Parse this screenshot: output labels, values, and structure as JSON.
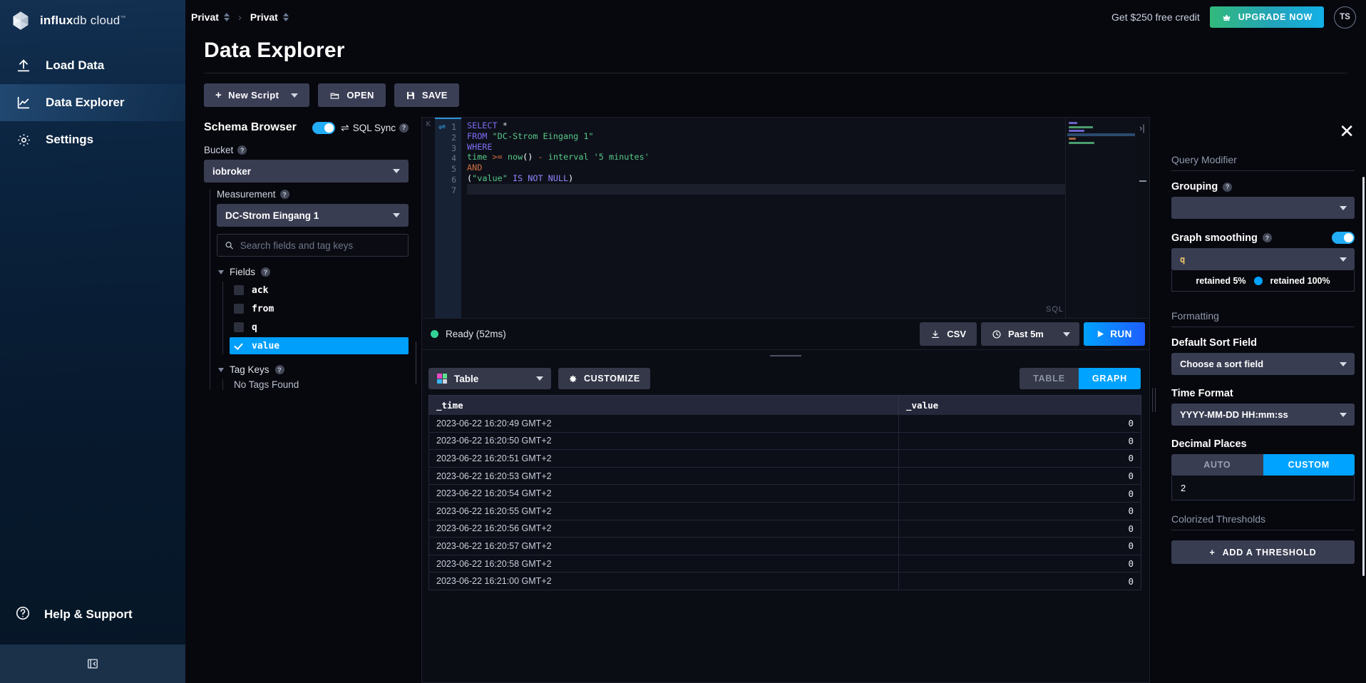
{
  "brand": {
    "bold": "influx",
    "light": "db cloud",
    "tm": "™"
  },
  "nav": {
    "items": [
      {
        "label": "Load Data",
        "icon": "upload-icon",
        "active": false
      },
      {
        "label": "Data Explorer",
        "icon": "line-chart-icon",
        "active": true
      },
      {
        "label": "Settings",
        "icon": "gear-icon",
        "active": false
      }
    ],
    "help": "Help & Support",
    "collapse_icon": "collapse-sidebar-icon"
  },
  "topbar": {
    "breadcrumb_org": "Privat",
    "breadcrumb_bucket": "Privat",
    "separator": "›",
    "free_credit": "Get $250 free credit",
    "upgrade_label": "UPGRADE NOW",
    "avatar_initials": "TS"
  },
  "page": {
    "title": "Data Explorer"
  },
  "script_bar": {
    "new_script": "New Script",
    "open": "OPEN",
    "save": "SAVE"
  },
  "schema": {
    "title": "Schema Browser",
    "sql_sync_label": "SQL Sync",
    "sql_sync_on": true,
    "bucket_label": "Bucket",
    "bucket_value": "iobroker",
    "measurement_label": "Measurement",
    "measurement_value": "DC-Strom Eingang 1",
    "search_placeholder": "Search fields and tag keys",
    "fields_label": "Fields",
    "fields": [
      {
        "name": "ack",
        "checked": false
      },
      {
        "name": "from",
        "checked": false
      },
      {
        "name": "q",
        "checked": false
      },
      {
        "name": "value",
        "checked": true
      }
    ],
    "tag_keys_label": "Tag Keys",
    "no_tags": "No Tags Found"
  },
  "editor": {
    "line_numbers": [
      "1",
      "2",
      "3",
      "4",
      "5",
      "6",
      "7"
    ],
    "k_label": "K",
    "sql_badge": "SQL",
    "lines": [
      {
        "n": 1,
        "tokens": [
          {
            "t": "SELECT",
            "c": "kw"
          },
          {
            "t": " ",
            "c": "plain"
          },
          {
            "t": "*",
            "c": "star"
          }
        ]
      },
      {
        "n": 2,
        "tokens": [
          {
            "t": "FROM",
            "c": "kw"
          },
          {
            "t": " ",
            "c": "plain"
          },
          {
            "t": "\"DC-Strom Eingang 1\"",
            "c": "str"
          }
        ]
      },
      {
        "n": 3,
        "tokens": [
          {
            "t": "WHERE",
            "c": "kw"
          }
        ]
      },
      {
        "n": 4,
        "tokens": [
          {
            "t": "time",
            "c": "ident"
          },
          {
            "t": " ",
            "c": "plain"
          },
          {
            "t": ">=",
            "c": "op"
          },
          {
            "t": " ",
            "c": "plain"
          },
          {
            "t": "now",
            "c": "ident"
          },
          {
            "t": "()",
            "c": "plain"
          },
          {
            "t": " ",
            "c": "plain"
          },
          {
            "t": "-",
            "c": "op"
          },
          {
            "t": " ",
            "c": "plain"
          },
          {
            "t": "interval",
            "c": "ident"
          },
          {
            "t": " ",
            "c": "plain"
          },
          {
            "t": "'5 minutes'",
            "c": "str"
          }
        ]
      },
      {
        "n": 5,
        "tokens": [
          {
            "t": "AND",
            "c": "and"
          }
        ]
      },
      {
        "n": 6,
        "tokens": [
          {
            "t": "(",
            "c": "plain"
          },
          {
            "t": "\"value\"",
            "c": "str"
          },
          {
            "t": " ",
            "c": "plain"
          },
          {
            "t": "IS NOT NULL",
            "c": "kw2"
          },
          {
            "t": ")",
            "c": "plain"
          }
        ]
      },
      {
        "n": 7,
        "tokens": []
      }
    ],
    "raw_query": "SELECT *\nFROM \"DC-Strom Eingang 1\"\nWHERE\ntime >= now() - interval '5 minutes'\nAND\n(\"value\" IS NOT NULL)\n"
  },
  "status": {
    "state_text": "Ready (52ms)",
    "state_color": "#32d296",
    "csv_label": "CSV",
    "time_range": "Past 5m",
    "run_label": "RUN"
  },
  "visualization": {
    "type_label": "Table",
    "customize_label": "CUSTOMIZE",
    "toggle": {
      "table": "TABLE",
      "graph": "GRAPH",
      "selected": "GRAPH"
    }
  },
  "results_table": {
    "columns": [
      "_time",
      "_value"
    ],
    "rows": [
      [
        "2023-06-22 16:20:49 GMT+2",
        "0"
      ],
      [
        "2023-06-22 16:20:50 GMT+2",
        "0"
      ],
      [
        "2023-06-22 16:20:51 GMT+2",
        "0"
      ],
      [
        "2023-06-22 16:20:53 GMT+2",
        "0"
      ],
      [
        "2023-06-22 16:20:54 GMT+2",
        "0"
      ],
      [
        "2023-06-22 16:20:55 GMT+2",
        "0"
      ],
      [
        "2023-06-22 16:20:56 GMT+2",
        "0"
      ],
      [
        "2023-06-22 16:20:57 GMT+2",
        "0"
      ],
      [
        "2023-06-22 16:20:58 GMT+2",
        "0"
      ],
      [
        "2023-06-22 16:21:00 GMT+2",
        "0"
      ]
    ]
  },
  "right_panel": {
    "close_icon": "close-icon",
    "query_modifier_title": "Query Modifier",
    "grouping_label": "Grouping",
    "grouping_value": "",
    "graph_smoothing_label": "Graph smoothing",
    "graph_smoothing_on": true,
    "smoothing_field": "q",
    "retained_low": "retained 5%",
    "retained_high": "retained 100%",
    "formatting_title": "Formatting",
    "default_sort_label": "Default Sort Field",
    "default_sort_value": "Choose a sort field",
    "time_format_label": "Time Format",
    "time_format_value": "YYYY-MM-DD HH:mm:ss",
    "decimal_places_label": "Decimal Places",
    "decimal_auto": "AUTO",
    "decimal_custom": "CUSTOM",
    "decimal_selected": "CUSTOM",
    "decimal_value": "2",
    "colorized_thresholds_title": "Colorized Thresholds",
    "add_threshold_label": "ADD A THRESHOLD"
  },
  "colors": {
    "accent": "#00a3ff",
    "accent_toggle": "#22adf6",
    "success": "#32d296",
    "panel": "#393d52",
    "bg": "#07070e",
    "nav_gradient_top": "#133051"
  }
}
